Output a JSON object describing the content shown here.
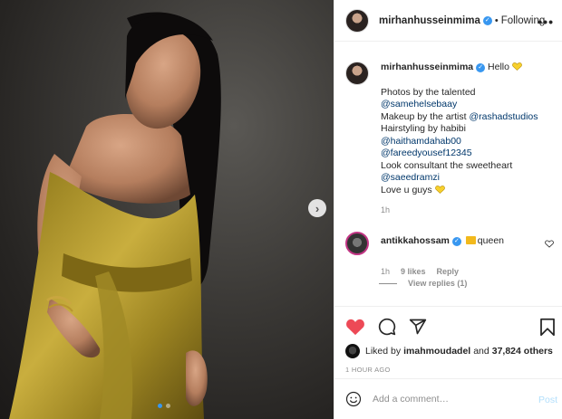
{
  "post": {
    "username": "mirhanhusseinmima",
    "follow_label": "Following",
    "more_label": "•••"
  },
  "caption": {
    "username": "mirhanhusseinmima",
    "first": "Hello",
    "line1": "Photos by the talented",
    "mention1": "@samehelsebaay",
    "line2_prefix": "Makeup by the artist ",
    "mention2": "@rashadstudios",
    "line3": "Hairstyling by habibi",
    "mention3": "@haithamdahab00",
    "mention4": "@fareedyousef12345",
    "line4": "Look consultant the sweetheart",
    "mention5": "@saeedramzi",
    "line5": "Love u guys",
    "time": "1h"
  },
  "comment": {
    "username": "antikkahossam",
    "text": "queen",
    "time": "1h",
    "likes": "9 likes",
    "reply": "Reply",
    "view_replies": "View replies (1)"
  },
  "likes": {
    "prefix": "Liked by",
    "user": "imahmoudadel",
    "mid": "and",
    "count": "37,824 others"
  },
  "posted": "1 HOUR AGO",
  "add_comment": {
    "placeholder": "Add a comment…",
    "post_label": "Post"
  },
  "carousel": {
    "slides": 2,
    "active": 0
  },
  "colors": {
    "accent": "#3897f0",
    "like_red": "#ed4956",
    "dress": "#b39a2a"
  }
}
